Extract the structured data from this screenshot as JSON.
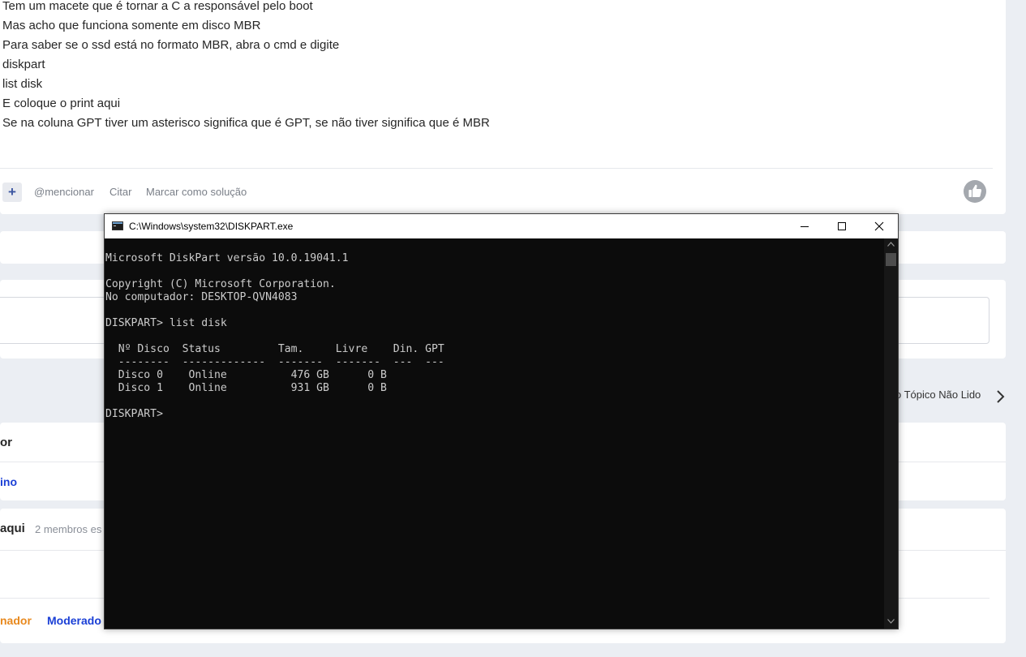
{
  "post": {
    "lines": [
      "Tem um macete que é tornar a C a responsável pelo boot",
      "Mas acho que funciona somente em disco MBR",
      "Para saber se o ssd está no formato MBR, abra o cmd e digite",
      "diskpart",
      "list disk",
      "E coloque o print aqui",
      "Se na coluna GPT tiver um asterisco significa que é GPT, se não tiver significa que é MBR"
    ],
    "actions": {
      "plus": "+",
      "mention": "@mencionar",
      "quote": "Citar",
      "mark_solution": "Marcar como solução"
    }
  },
  "navigation": {
    "next_topic": "o Tópico Não Lido"
  },
  "author_section": {
    "title": "or",
    "name": "ino"
  },
  "online_section": {
    "title": "aqui",
    "count": "2 membros es",
    "roles": [
      "nador",
      "Moderado"
    ]
  },
  "cmd": {
    "title": "C:\\Windows\\system32\\DISKPART.exe",
    "output": "Microsoft DiskPart versão 10.0.19041.1\n\nCopyright (C) Microsoft Corporation.\nNo computador: DESKTOP-QVN4083\n\nDISKPART> list disk\n\n  Nº Disco  Status         Tam.     Livre    Din. GPT\n  --------  -------------  -------  -------  ---  ---\n  Disco 0    Online          476 GB      0 B\n  Disco 1    Online          931 GB      0 B\n\nDISKPART> "
  },
  "colors": {
    "page_bg": "#ebeef3",
    "link_blue": "#1a3fd6",
    "admin_orange": "#e8891e",
    "console_bg": "#0c0c0c",
    "console_text": "#cccccc"
  }
}
